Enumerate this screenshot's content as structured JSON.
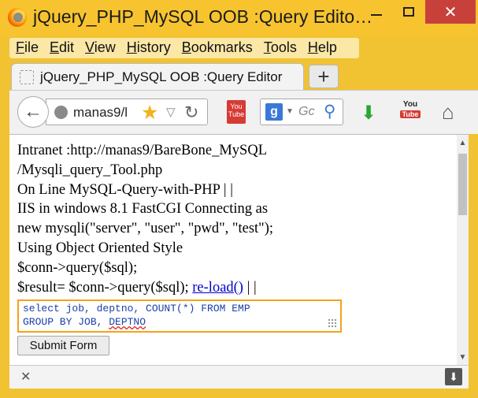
{
  "window": {
    "title": "jQuery_PHP_MySQL OOB :Query Edito…",
    "minimize": "—",
    "close": "✕"
  },
  "menu": [
    "File",
    "Edit",
    "View",
    "History",
    "Bookmarks",
    "Tools",
    "Help"
  ],
  "tab": {
    "label": "jQuery_PHP_MySQL OOB :Query Editor",
    "new_tab": "+"
  },
  "nav": {
    "back": "←",
    "url": "manas9/l",
    "search_engine": "g",
    "search_placeholder": "Gc",
    "youtube_label": "You Tube",
    "youtube2_top": "You",
    "youtube2_bottom": "Tube"
  },
  "content": {
    "lines": [
      "Intranet :http://manas9/BareBone_MySQL",
      "/Mysqli_query_Tool.php",
      "On Line MySQL-Query-with-PHP | |",
      "IIS in windows 8.1 FastCGI Connecting as",
      "new mysqli(\"server\", \"user\", \"pwd\", \"test\");",
      "Using Object Oriented Style",
      "$conn->query($sql);"
    ],
    "result_prefix": "$result= $conn->query($sql); ",
    "reload_link": "re-load()",
    "result_suffix": " | |",
    "query_line1": "select job, deptno, COUNT(*) FROM EMP",
    "query_line2_prefix": "GROUP BY JOB, ",
    "query_line2_misspelled": "DEPTNO",
    "submit_label": "Submit Form"
  },
  "colors": {
    "window_frame": "#f7c430",
    "close_button": "#c7413a",
    "textarea_border": "#f2a417",
    "link": "#0000cc"
  }
}
